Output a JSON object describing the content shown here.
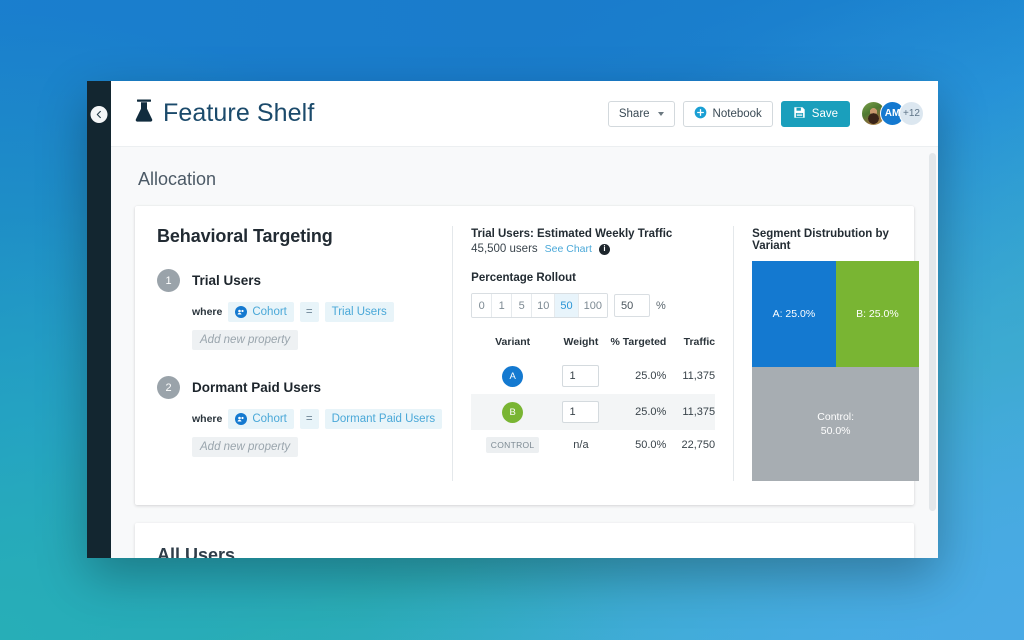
{
  "app": {
    "title": "Feature Shelf",
    "logo_icon": "flask-icon",
    "sidebar_toggle_icon": "collapse-circle-icon"
  },
  "toolbar": {
    "share_label": "Share",
    "share_caret_icon": "chevron-down-icon",
    "notebook_label": "Notebook",
    "notebook_icon": "plus-circle-icon",
    "save_label": "Save",
    "save_icon": "floppy-disk-icon",
    "avatars": [
      {
        "type": "photo",
        "label": ""
      },
      {
        "type": "initials",
        "label": "AM"
      },
      {
        "type": "overflow",
        "label": "+12"
      }
    ]
  },
  "page": {
    "section_title": "Allocation"
  },
  "targeting": {
    "heading": "Behavioral Targeting",
    "add_property_label": "Add new property",
    "where_label": "where",
    "operator": "=",
    "cohort_label": "Cohort",
    "cohort_icon": "cohort-icon",
    "rules": [
      {
        "number": "1",
        "name": "Trial Users",
        "value": "Trial Users"
      },
      {
        "number": "2",
        "name": "Dormant Paid Users",
        "value": "Dormant Paid Users"
      }
    ]
  },
  "allocation": {
    "traffic_label": "Trial Users: Estimated Weekly Traffic",
    "traffic_users": "45,500 users",
    "see_chart_label": "See Chart",
    "info_icon": "info-icon",
    "rollout_label": "Percentage Rollout",
    "rollout_options": [
      "0",
      "1",
      "5",
      "10",
      "50",
      "100"
    ],
    "rollout_selected": "50",
    "rollout_input_value": "50",
    "rollout_unit": "%",
    "table": {
      "headers": [
        "Variant",
        "Weight",
        "% Targeted",
        "Traffic"
      ],
      "rows": [
        {
          "variant": "A",
          "variant_type": "badge-a",
          "weight": "1",
          "weight_type": "input",
          "targeted": "25.0%",
          "traffic": "11,375"
        },
        {
          "variant": "B",
          "variant_type": "badge-b",
          "weight": "1",
          "weight_type": "input",
          "targeted": "25.0%",
          "traffic": "11,375"
        },
        {
          "variant": "CONTROL",
          "variant_type": "badge-control",
          "weight": "n/a",
          "weight_type": "text",
          "targeted": "50.0%",
          "traffic": "22,750"
        }
      ]
    }
  },
  "chart_data": {
    "type": "pie",
    "title": "Segment Distrubution by Variant",
    "categories": [
      "A",
      "B",
      "Control"
    ],
    "values": [
      25.0,
      25.0,
      50.0
    ],
    "labels": [
      "A: 25.0%",
      "B: 25.0%",
      "Control:\n50.0%"
    ],
    "colors": [
      "#1479d0",
      "#79b533",
      "#a7adb2"
    ],
    "unit": "%",
    "legend": "none",
    "label_a": "A: 25.0%",
    "label_b": "B: 25.0%",
    "label_control_line1": "Control:",
    "label_control_line2": "50.0%"
  },
  "bottom_section": {
    "title": "All Users"
  },
  "colors": {
    "brand_navy": "#1b4a6b",
    "accent_blue": "#1479d0",
    "accent_green": "#79b533",
    "save_teal": "#1a9fbc",
    "control_gray": "#a7adb2",
    "sidebar_dark": "#132630"
  }
}
